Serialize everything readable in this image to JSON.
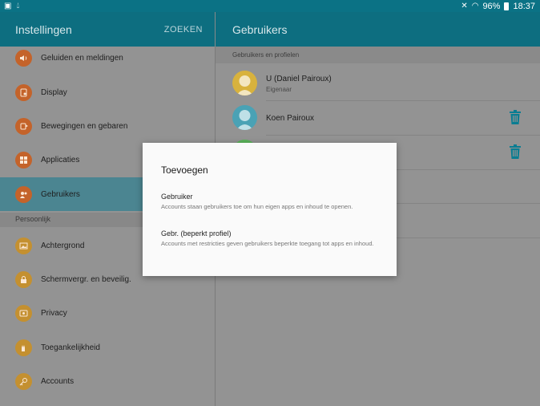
{
  "status_bar": {
    "battery": "96%",
    "time": "18:37"
  },
  "left": {
    "title": "Instellingen",
    "search_label": "ZOEKEN",
    "items": [
      {
        "label": "Geluiden en meldingen",
        "icon": "sound-icon",
        "color": "#c4632a"
      },
      {
        "label": "Display",
        "icon": "display-icon",
        "color": "#c4632a"
      },
      {
        "label": "Bewegingen en gebaren",
        "icon": "motion-icon",
        "color": "#c4632a"
      },
      {
        "label": "Applicaties",
        "icon": "apps-icon",
        "color": "#c4632a"
      },
      {
        "label": "Gebruikers",
        "icon": "users-icon",
        "color": "#c4632a"
      }
    ],
    "section": "Persoonlijk",
    "personal_items": [
      {
        "label": "Achtergrond",
        "icon": "wallpaper-icon",
        "color": "#c49030"
      },
      {
        "label": "Schermvergr. en beveilig.",
        "icon": "lock-icon",
        "color": "#c49030"
      },
      {
        "label": "Privacy",
        "icon": "privacy-icon",
        "color": "#c49030"
      },
      {
        "label": "Toegankelijkheid",
        "icon": "accessibility-icon",
        "color": "#c49030"
      },
      {
        "label": "Accounts",
        "icon": "key-icon",
        "color": "#c49030"
      }
    ]
  },
  "right": {
    "title": "Gebruikers",
    "section": "Gebruikers en profielen",
    "users": [
      {
        "name": "U (Daniel Pairoux)",
        "role": "Eigenaar"
      },
      {
        "name": "Koen Pairoux",
        "role": ""
      }
    ]
  },
  "dialog": {
    "title": "Toevoegen",
    "options": [
      {
        "title": "Gebruiker",
        "desc": "Accounts staan gebruikers toe om hun eigen apps en inhoud te openen."
      },
      {
        "title": "Gebr. (beperkt profiel)",
        "desc": "Accounts met restricties geven gebruikers beperkte toegang tot apps en inhoud."
      }
    ]
  },
  "colors": {
    "accent": "#0d6e80",
    "delete_icon": "#0a7d92"
  }
}
